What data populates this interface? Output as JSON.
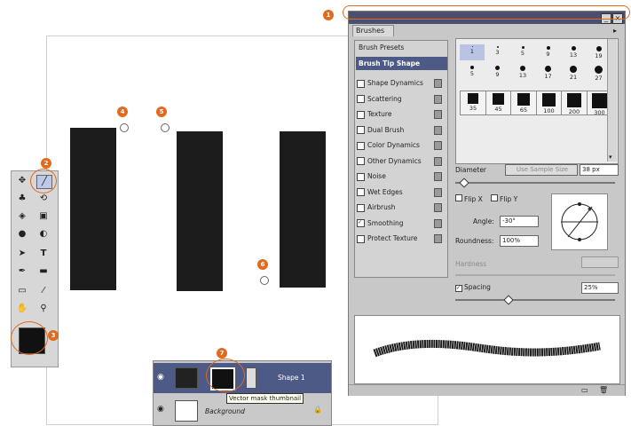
{
  "brushes_panel": {
    "title": "Brushes",
    "tab_label": "Brushes",
    "presets_label": "Brush Presets",
    "tip_shape_label": "Brush Tip Shape",
    "options": [
      {
        "label": "Shape Dynamics",
        "checked": false
      },
      {
        "label": "Scattering",
        "checked": false
      },
      {
        "label": "Texture",
        "checked": false
      },
      {
        "label": "Dual Brush",
        "checked": false
      },
      {
        "label": "Color Dynamics",
        "checked": false
      },
      {
        "label": "Other Dynamics",
        "checked": false
      },
      {
        "label": "Noise",
        "checked": false
      },
      {
        "label": "Wet Edges",
        "checked": false
      },
      {
        "label": "Airbrush",
        "checked": false
      },
      {
        "label": "Smoothing",
        "checked": true
      },
      {
        "label": "Protect Texture",
        "checked": false
      }
    ],
    "tip_sizes": [
      "1",
      "3",
      "5",
      "9",
      "13",
      "19",
      "5",
      "9",
      "13",
      "17",
      "21",
      "27",
      "35",
      "45",
      "65",
      "100",
      "200",
      "300"
    ],
    "diameter_label": "Diameter",
    "use_sample_size_label": "Use Sample Size",
    "diameter_value": "38 px",
    "flip_x_label": "Flip X",
    "flip_y_label": "Flip Y",
    "angle_label": "Angle:",
    "angle_value": "-30°",
    "roundness_label": "Roundness:",
    "roundness_value": "100%",
    "hardness_label": "Hardness",
    "spacing_label": "Spacing",
    "spacing_value": "25%",
    "spacing_checked": true
  },
  "layers_panel": {
    "layer_name": "Shape 1",
    "background_name": "Background",
    "tooltip": "Vector mask thumbnail"
  },
  "markers": [
    "1",
    "2",
    "3",
    "4",
    "5",
    "6",
    "7"
  ],
  "colors": {
    "accent": "#e06a1e",
    "titlebar": "#4c4f6e",
    "selection": "#4e5a86",
    "stroke": "#1c1c1c"
  }
}
